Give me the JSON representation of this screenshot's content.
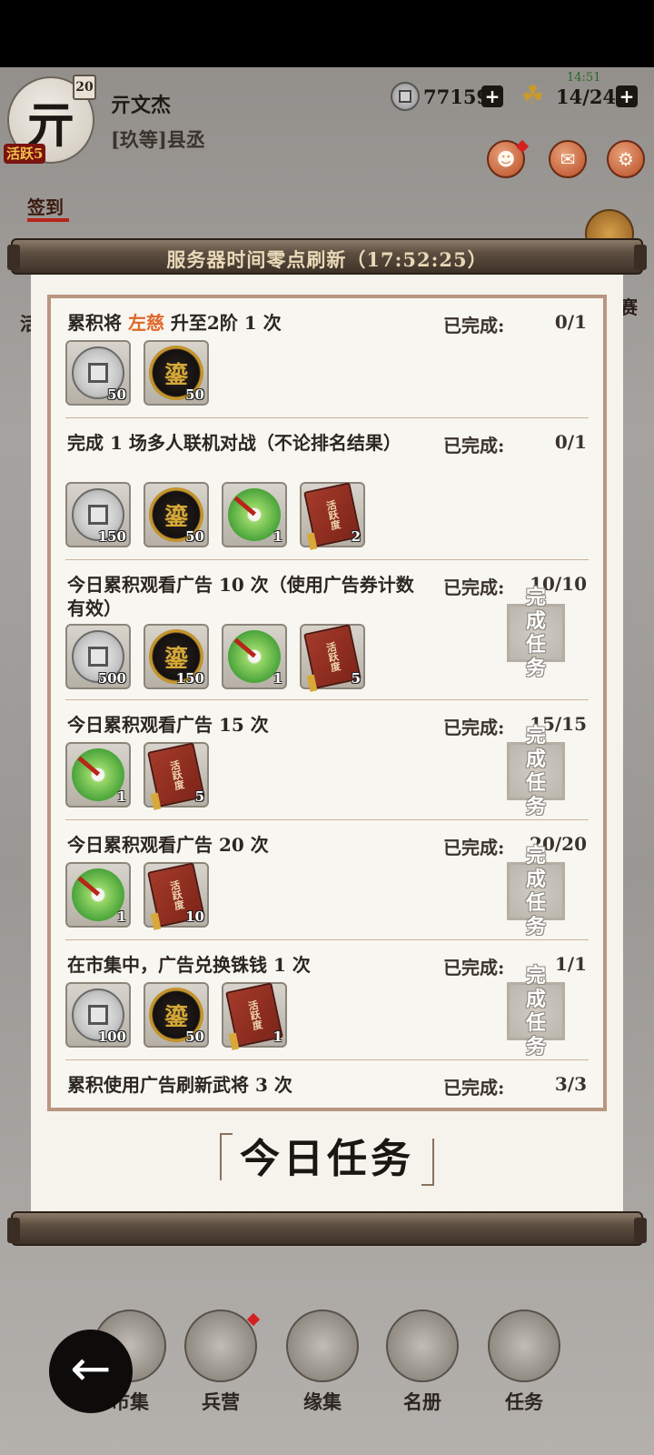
{
  "header": {
    "avatar_char": "亓",
    "level": "20",
    "activity": "活跃5",
    "name": "亓文杰",
    "rank": "[玖等]县丞",
    "clock": "14:51",
    "coins": "77159",
    "grain": "14/24",
    "plus": "+"
  },
  "side": {
    "left_top": "签到",
    "left_mid": "活",
    "right_mid": "赛"
  },
  "scroll": {
    "refresh_text": "服务器时间零点刷新（17:52:25）",
    "tab_title": "今日任务"
  },
  "tasks": [
    {
      "title_prefix": "累积将 ",
      "title_highlight": "左慈",
      "title_suffix": " 升至2阶 1 次",
      "status": "已完成:",
      "progress": "0/1",
      "rewards": [
        {
          "type": "copper",
          "qty": "50"
        },
        {
          "type": "gold",
          "qty": "50"
        }
      ],
      "button": ""
    },
    {
      "title_prefix": "完成 1 场多人联机对战（不论排名结果）",
      "title_highlight": "",
      "title_suffix": "",
      "status": "已完成:",
      "progress": "0/1",
      "rewards": [
        {
          "type": "copper",
          "qty": "150"
        },
        {
          "type": "gold",
          "qty": "50"
        },
        {
          "type": "jade",
          "qty": "1"
        },
        {
          "type": "book",
          "qty": "2"
        }
      ],
      "button": ""
    },
    {
      "title_prefix": "今日累积观看广告 10 次（使用广告券计数有效）",
      "title_highlight": "",
      "title_suffix": "",
      "status": "已完成:",
      "progress": "10/10",
      "rewards": [
        {
          "type": "copper",
          "qty": "500"
        },
        {
          "type": "gold",
          "qty": "150"
        },
        {
          "type": "jade",
          "qty": "1"
        },
        {
          "type": "book",
          "qty": "5"
        }
      ],
      "button": "完成任务"
    },
    {
      "title_prefix": "今日累积观看广告 15 次",
      "title_highlight": "",
      "title_suffix": "",
      "status": "已完成:",
      "progress": "15/15",
      "rewards": [
        {
          "type": "jade",
          "qty": "1"
        },
        {
          "type": "book",
          "qty": "5"
        }
      ],
      "button": "完成任务"
    },
    {
      "title_prefix": "今日累积观看广告 20 次",
      "title_highlight": "",
      "title_suffix": "",
      "status": "已完成:",
      "progress": "20/20",
      "rewards": [
        {
          "type": "jade",
          "qty": "1"
        },
        {
          "type": "book",
          "qty": "10"
        }
      ],
      "button": "完成任务"
    },
    {
      "title_prefix": "在市集中，广告兑换铢钱 1 次",
      "title_highlight": "",
      "title_suffix": "",
      "status": "已完成:",
      "progress": "1/1",
      "rewards": [
        {
          "type": "copper",
          "qty": "100"
        },
        {
          "type": "gold",
          "qty": "50"
        },
        {
          "type": "book",
          "qty": "1"
        }
      ],
      "button": "完成任务"
    },
    {
      "title_prefix": "累积使用广告刷新武将 3 次",
      "title_highlight": "",
      "title_suffix": "",
      "status": "已完成:",
      "progress": "3/3",
      "rewards": [],
      "button": ""
    }
  ],
  "reward_text": {
    "copper": "",
    "gold": "鎏",
    "jade": "",
    "book": "活跃度"
  },
  "bottom_nav": [
    {
      "label": "市集",
      "icon": "market-icon"
    },
    {
      "label": "兵营",
      "icon": "barracks-icon"
    },
    {
      "label": "缘集",
      "icon": "fate-book-icon"
    },
    {
      "label": "名册",
      "icon": "roster-icon"
    },
    {
      "label": "任务",
      "icon": "task-scroll-icon"
    }
  ],
  "back_label": "←"
}
